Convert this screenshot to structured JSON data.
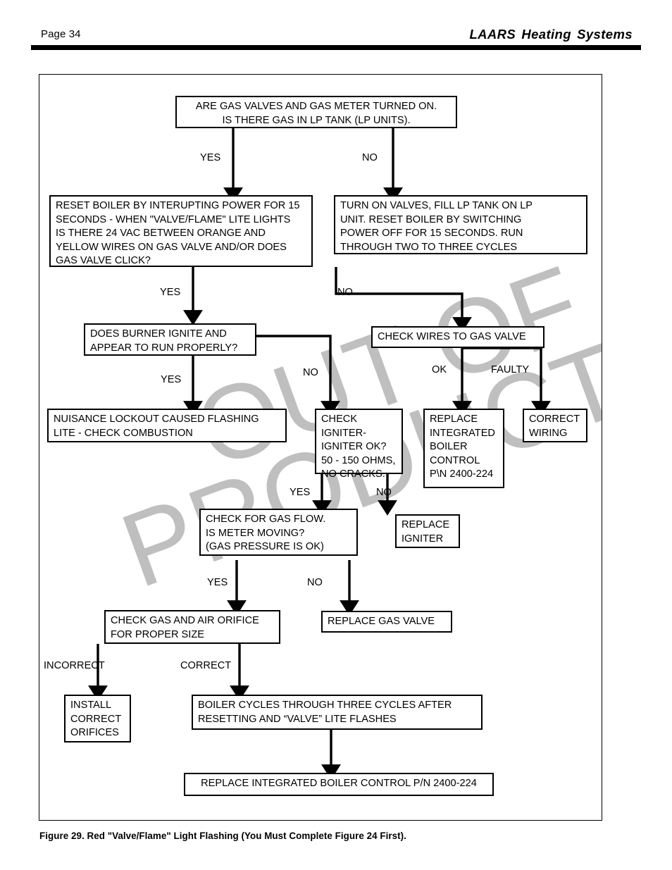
{
  "header": {
    "page_label": "Page 34",
    "brand": "LAARS Heating Systems"
  },
  "watermark": {
    "line1": "OUT OF",
    "line2": "PRODUCTION"
  },
  "caption": "Figure 29. Red \"Valve/Flame\" Light Flashing (You Must Complete Figure 24 First).",
  "colors": {
    "ink": "#000000",
    "paper": "#ffffff",
    "watermark": "#bfbfbf"
  },
  "chart_data": {
    "type": "diagram",
    "title": "Red \"Valve/Flame\" Light Flashing troubleshooting flowchart",
    "nodes": [
      {
        "id": "n1",
        "text": "ARE GAS VALVES AND GAS METER TURNED ON.\nIS THERE GAS IN LP TANK (LP UNITS)."
      },
      {
        "id": "n2",
        "text": "RESET BOILER BY INTERUPTING POWER FOR 15\nSECONDS - WHEN \"VALVE/FLAME\" LITE LIGHTS\nIS THERE 24 VAC BETWEEN ORANGE AND\nYELLOW WIRES ON GAS VALVE AND/OR DOES\nGAS VALVE CLICK?"
      },
      {
        "id": "n3",
        "text": "TURN ON VALVES, FILL LP TANK ON LP\nUNIT. RESET BOILER BY SWITCHING\nPOWER OFF FOR 15 SECONDS. RUN\nTHROUGH TWO TO THREE CYCLES"
      },
      {
        "id": "n4",
        "text": "DOES BURNER IGNITE AND\nAPPEAR TO RUN PROPERLY?"
      },
      {
        "id": "n5",
        "text": "CHECK WIRES TO GAS VALVE"
      },
      {
        "id": "n6",
        "text": "NUISANCE LOCKOUT CAUSED FLASHING\nLITE - CHECK COMBUSTION"
      },
      {
        "id": "n7",
        "text": "CHECK IGNITER-\nIGNITER OK?\n50 - 150 OHMS,\nNO CRACKS."
      },
      {
        "id": "n8",
        "text": "REPLACE\nINTEGRATED\nBOILER\nCONTROL\nP\\N 2400-224"
      },
      {
        "id": "n9",
        "text": "CORRECT\nWIRING"
      },
      {
        "id": "n10",
        "text": "CHECK FOR GAS FLOW.\nIS METER MOVING?\n(GAS PRESSURE IS OK)"
      },
      {
        "id": "n11",
        "text": "REPLACE\nIGNITER"
      },
      {
        "id": "n12",
        "text": "CHECK GAS AND AIR ORIFICE\nFOR PROPER SIZE"
      },
      {
        "id": "n13",
        "text": "REPLACE GAS VALVE"
      },
      {
        "id": "n14",
        "text": "INSTALL\nCORRECT\nORIFICES"
      },
      {
        "id": "n15",
        "text": "BOILER CYCLES THROUGH THREE CYCLES AFTER\nRESETTING AND “VALVE” LITE FLASHES"
      },
      {
        "id": "n16",
        "text": "REPLACE INTEGRATED BOILER CONTROL P/N 2400-224"
      }
    ],
    "edges": [
      {
        "from": "n1",
        "to": "n2",
        "label": "YES"
      },
      {
        "from": "n1",
        "to": "n3",
        "label": "NO"
      },
      {
        "from": "n2",
        "to": "n4",
        "label": "YES"
      },
      {
        "from": "n3",
        "to": "n5",
        "label": "NO"
      },
      {
        "from": "n4",
        "to": "n6",
        "label": "YES"
      },
      {
        "from": "n4",
        "to": "n7",
        "label": "NO"
      },
      {
        "from": "n5",
        "to": "n8",
        "label": "OK"
      },
      {
        "from": "n5",
        "to": "n9",
        "label": "FAULTY"
      },
      {
        "from": "n7",
        "to": "n10",
        "label": "YES"
      },
      {
        "from": "n7",
        "to": "n11",
        "label": "NO"
      },
      {
        "from": "n10",
        "to": "n12",
        "label": "YES"
      },
      {
        "from": "n10",
        "to": "n13",
        "label": "NO"
      },
      {
        "from": "n12",
        "to": "n14",
        "label": "INCORRECT"
      },
      {
        "from": "n12",
        "to": "n15",
        "label": "CORRECT"
      },
      {
        "from": "n15",
        "to": "n16",
        "label": ""
      }
    ],
    "edge_labels": [
      {
        "id": "l1",
        "text": "YES"
      },
      {
        "id": "l2",
        "text": "NO"
      },
      {
        "id": "l3",
        "text": "YES"
      },
      {
        "id": "l4",
        "text": "NO"
      },
      {
        "id": "l5",
        "text": "YES"
      },
      {
        "id": "l6",
        "text": "NO"
      },
      {
        "id": "l7",
        "text": "OK"
      },
      {
        "id": "l8",
        "text": "FAULTY"
      },
      {
        "id": "l9",
        "text": "YES"
      },
      {
        "id": "l10",
        "text": "NO"
      },
      {
        "id": "l11",
        "text": "YES"
      },
      {
        "id": "l12",
        "text": "NO"
      },
      {
        "id": "l13",
        "text": "INCORRECT"
      },
      {
        "id": "l14",
        "text": "CORRECT"
      }
    ]
  }
}
